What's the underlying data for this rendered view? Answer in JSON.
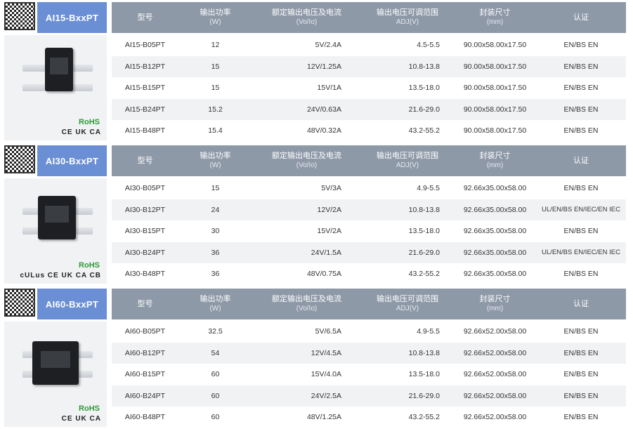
{
  "headers": {
    "model": "型号",
    "power": "输出功率",
    "power_unit": "(W)",
    "rated": "额定输出电压及电流",
    "rated_unit": "(Vo/Io)",
    "adj": "输出电压可调范围",
    "adj_unit": "ADJ(V)",
    "size": "封装尺寸",
    "size_unit": "(mm)",
    "cert": "认证"
  },
  "sections": [
    {
      "series": "AI15-BxxPT",
      "rohs": "RoHS",
      "certs": "CE UK CA",
      "rows": [
        {
          "model": "AI15-B05PT",
          "power": "12",
          "rated": "5V/2.4A",
          "adj": "4.5-5.5",
          "size": "90.00x58.00x17.50",
          "cert": "EN/BS EN"
        },
        {
          "model": "AI15-B12PT",
          "power": "15",
          "rated": "12V/1.25A",
          "adj": "10.8-13.8",
          "size": "90.00x58.00x17.50",
          "cert": "EN/BS EN"
        },
        {
          "model": "AI15-B15PT",
          "power": "15",
          "rated": "15V/1A",
          "adj": "13.5-18.0",
          "size": "90.00x58.00x17.50",
          "cert": "EN/BS EN"
        },
        {
          "model": "AI15-B24PT",
          "power": "15.2",
          "rated": "24V/0.63A",
          "adj": "21.6-29.0",
          "size": "90.00x58.00x17.50",
          "cert": "EN/BS EN"
        },
        {
          "model": "AI15-B48PT",
          "power": "15.4",
          "rated": "48V/0.32A",
          "adj": "43.2-55.2",
          "size": "90.00x58.00x17.50",
          "cert": "EN/BS EN"
        }
      ]
    },
    {
      "series": "AI30-BxxPT",
      "rohs": "RoHS",
      "certs": "cULus CE UK CA CB",
      "rows": [
        {
          "model": "AI30-B05PT",
          "power": "15",
          "rated": "5V/3A",
          "adj": "4.9-5.5",
          "size": "92.66x35.00x58.00",
          "cert": "EN/BS EN"
        },
        {
          "model": "AI30-B12PT",
          "power": "24",
          "rated": "12V/2A",
          "adj": "10.8-13.8",
          "size": "92.66x35.00x58.00",
          "cert": "UL/EN/BS EN/IEC/EN IEC"
        },
        {
          "model": "AI30-B15PT",
          "power": "30",
          "rated": "15V/2A",
          "adj": "13.5-18.0",
          "size": "92.66x35.00x58.00",
          "cert": "EN/BS EN"
        },
        {
          "model": "AI30-B24PT",
          "power": "36",
          "rated": "24V/1.5A",
          "adj": "21.6-29.0",
          "size": "92.66x35.00x58.00",
          "cert": "UL/EN/BS EN/IEC/EN IEC"
        },
        {
          "model": "AI30-B48PT",
          "power": "36",
          "rated": "48V/0.75A",
          "adj": "43.2-55.2",
          "size": "92.66x35.00x58.00",
          "cert": "EN/BS EN"
        }
      ]
    },
    {
      "series": "AI60-BxxPT",
      "rohs": "RoHS",
      "certs": "CE UK CA",
      "rows": [
        {
          "model": "AI60-B05PT",
          "power": "32.5",
          "rated": "5V/6.5A",
          "adj": "4.9-5.5",
          "size": "92.66x52.00x58.00",
          "cert": "EN/BS EN"
        },
        {
          "model": "AI60-B12PT",
          "power": "54",
          "rated": "12V/4.5A",
          "adj": "10.8-13.8",
          "size": "92.66x52.00x58.00",
          "cert": "EN/BS EN"
        },
        {
          "model": "AI60-B15PT",
          "power": "60",
          "rated": "15V/4.0A",
          "adj": "13.5-18.0",
          "size": "92.66x52.00x58.00",
          "cert": "EN/BS EN"
        },
        {
          "model": "AI60-B24PT",
          "power": "60",
          "rated": "24V/2.5A",
          "adj": "21.6-29.0",
          "size": "92.66x52.00x58.00",
          "cert": "EN/BS EN"
        },
        {
          "model": "AI60-B48PT",
          "power": "60",
          "rated": "48V/1.25A",
          "adj": "43.2-55.2",
          "size": "92.66x52.00x58.00",
          "cert": "EN/BS EN"
        }
      ]
    }
  ],
  "colors": {
    "series_tag": "#6b8fd4",
    "table_header": "#8e99a8",
    "row_alt": "#f1f2f4",
    "rohs": "#2e9a3a"
  }
}
